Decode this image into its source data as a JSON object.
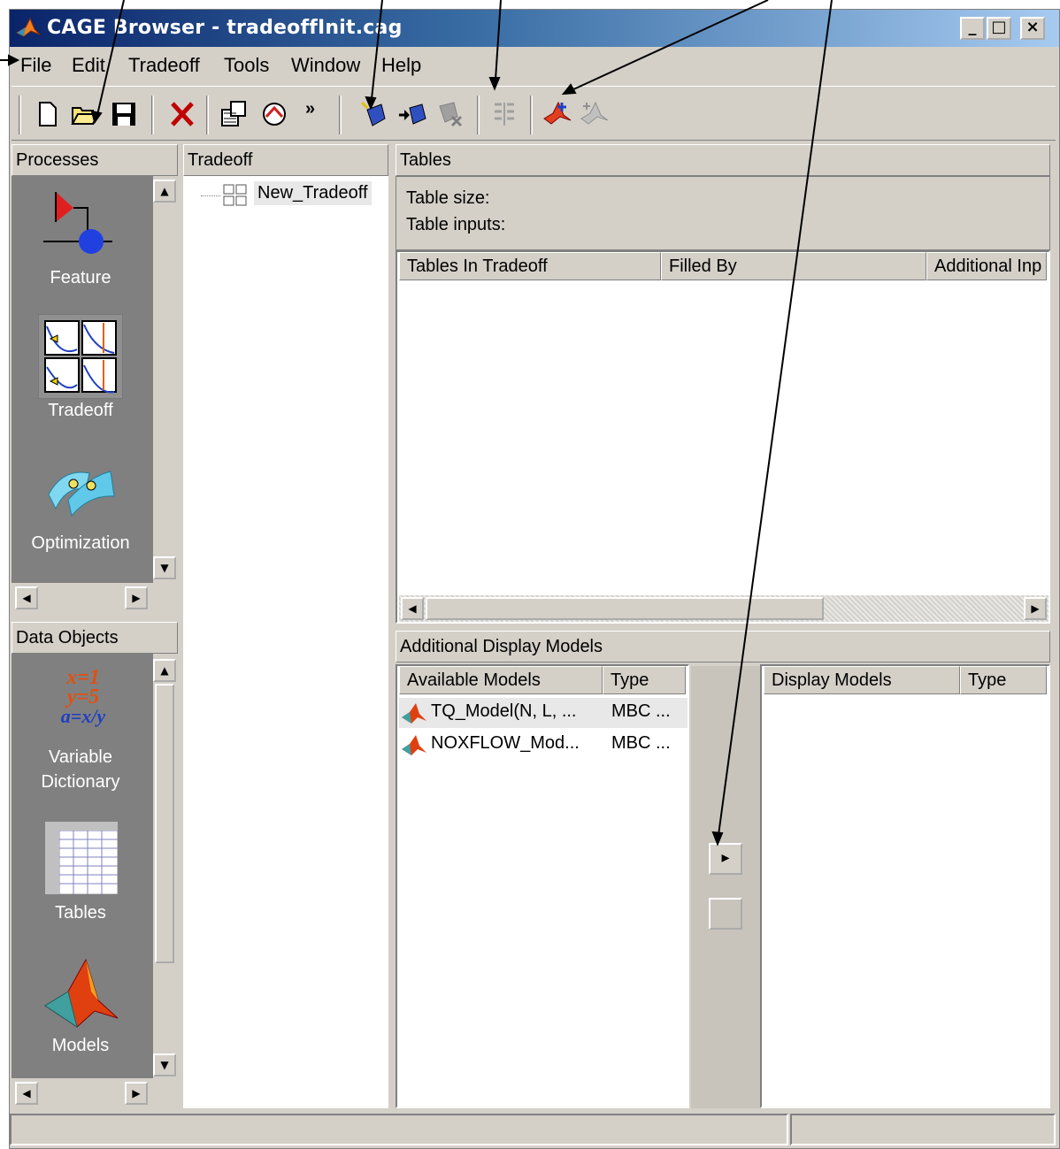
{
  "window": {
    "title": "CAGE Browser - tradeoffInit.cag",
    "minimize_glyph": "_",
    "maximize_glyph": "□",
    "close_glyph": "×"
  },
  "menu": [
    "File",
    "Edit",
    "Tradeoff",
    "Tools",
    "Window",
    "Help"
  ],
  "toolbar": {
    "icons": [
      "new-icon",
      "open-icon",
      "save-icon",
      "delete-icon",
      "import-icon",
      "export-icon",
      "more-icon",
      "add-table-icon",
      "add-table-from-model-icon",
      "remove-table-icon",
      "fill-icon",
      "add-display-model-icon",
      "remove-display-model-icon"
    ],
    "overflow": "»"
  },
  "processes": {
    "header": "Processes",
    "items": [
      {
        "label": "Feature",
        "icon": "feature-icon"
      },
      {
        "label": "Tradeoff",
        "icon": "tradeoff-icon"
      },
      {
        "label": "Optimization",
        "icon": "optimization-icon"
      }
    ]
  },
  "data_objects": {
    "header": "Data Objects",
    "items": [
      {
        "label": "Variable",
        "label2": "Dictionary",
        "icon": "variable-dictionary-icon"
      },
      {
        "label": "Tables",
        "icon": "tables-icon"
      },
      {
        "label": "Models",
        "icon": "models-icon"
      }
    ],
    "var_icon_lines": [
      "x=1",
      "y=5",
      "a=x/y"
    ]
  },
  "tradeoff_tree": {
    "header": "Tradeoff",
    "node": "New_Tradeoff"
  },
  "tables": {
    "header": "Tables",
    "table_size_label": "Table size:",
    "table_inputs_label": "Table inputs:",
    "columns": [
      "Tables In Tradeoff",
      "Filled By",
      "Additional Inp"
    ]
  },
  "display_models": {
    "header": "Additional Display Models",
    "available_columns": [
      "Available Models",
      "Type"
    ],
    "available": [
      {
        "name": "TQ_Model(N, L, ...",
        "type": "MBC ..."
      },
      {
        "name": "NOXFLOW_Mod...",
        "type": "MBC ..."
      }
    ],
    "display_columns": [
      "Display Models",
      "Type"
    ],
    "add_glyph": "▸"
  },
  "colors": {
    "face": "#d4d0c8",
    "title_start": "#0a246a",
    "title_end": "#a6caf0",
    "process_bg": "#808080",
    "selection": "#d4d0c8"
  }
}
